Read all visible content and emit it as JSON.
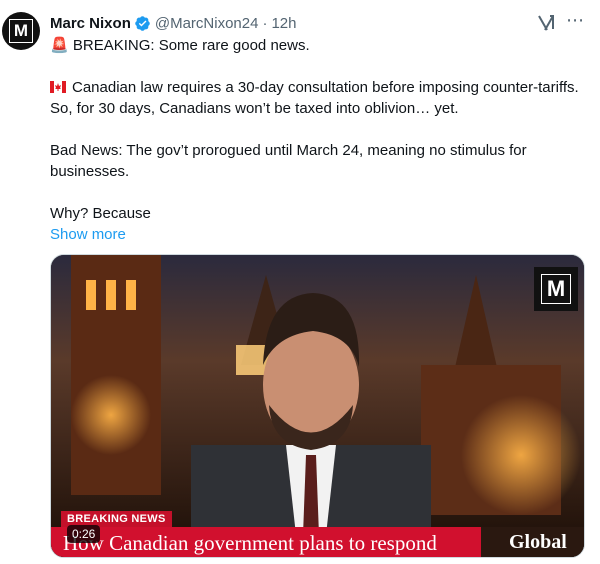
{
  "author": {
    "name": "Marc Nixon",
    "handle": "@MarcNixon24",
    "separator": "·",
    "time": "12h",
    "avatar_letter": "M"
  },
  "actions": {
    "grok_icon": "grok-icon",
    "more_icon": "⋯"
  },
  "tweet": {
    "line1_icon": "🚨",
    "line1": "BREAKING: Some rare good news.",
    "para2": "Canadian law requires a 30-day consultation before imposing counter-tariffs. So, for 30 days, Canadians won’t be taxed into oblivion… yet.",
    "para3": "Bad News: The gov’t prorogued until March 24, meaning no stimulus for businesses.",
    "para4": "Why? Because",
    "show_more": "Show more"
  },
  "video": {
    "watermark_letter": "M",
    "breaking_label": "BREAKING NEWS",
    "headline": "How Canadian government plans to respond",
    "network": "Global",
    "timer": "0:26"
  },
  "colors": {
    "link": "#1d9bf0",
    "verified": "#1d9bf0",
    "breaking_red": "#c4102a"
  }
}
